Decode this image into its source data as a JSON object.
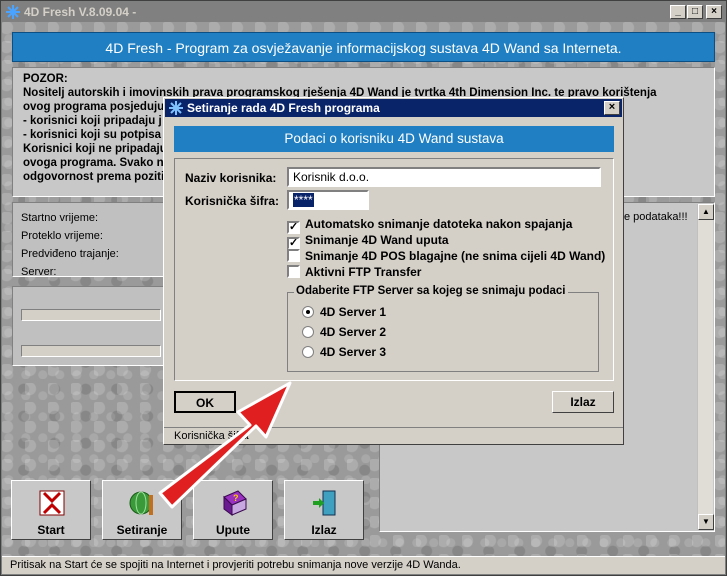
{
  "window": {
    "title": "4D Fresh V.8.09.04 -",
    "minimize": "_",
    "maximize": "□",
    "close": "×"
  },
  "banner": "4D Fresh - Program za osvježavanje informacijskog sustava 4D Wand sa Interneta.",
  "pozor": [
    "POZOR:",
    "Nositelj autorskih i imovinskih prava programskog rješenja 4D Wand je tvrtka 4th Dimension Inc. te pravo korištenja",
    "ovog programa posjeduju",
    "- korisnici koji pripadaju j",
    "- korisnici koji su potpisa",
    "Korisnici koji ne pripadaju                                                                                   o korištenja",
    "ovoga programa. Svako n                                                                                      aterijalnu",
    "odgovornost prema poziti"
  ],
  "info": {
    "start": "Startno vrijeme:",
    "elapsed": "Proteklo vrijeme:",
    "predicted": "Predviđeno trajanje:",
    "server": "Server:"
  },
  "log": {
    "text": "e podataka!!!"
  },
  "buttons": {
    "start": "Start",
    "settings": "Setiranje",
    "help": "Upute",
    "exit": "Izlaz"
  },
  "status": "Pritisak na Start će se spojiti na Internet i provjeriti potrebu snimanja nove verzije 4D Wanda.",
  "dialog": {
    "title": "Setiranje rada 4D Fresh programa",
    "close": "×",
    "banner": "Podaci o korisniku 4D Wand sustava",
    "username_label": "Naziv korisnika:",
    "username_value": "Korisnik d.o.o.",
    "password_label": "Korisnička šifra:",
    "password_value": "****",
    "checkboxes": [
      {
        "label": "Automatsko snimanje datoteka nakon spajanja",
        "checked": "✓"
      },
      {
        "label": "Snimanje 4D Wand uputa",
        "checked": "✓"
      },
      {
        "label": "Snimanje 4D POS blagajne (ne snima cijeli 4D Wand)",
        "checked": ""
      },
      {
        "label": "Aktivni FTP Transfer",
        "checked": ""
      }
    ],
    "group_title": "Odaberite FTP Server sa kojeg se snimaju podaci",
    "radios": [
      "4D Server 1",
      "4D Server 2",
      "4D Server 3"
    ],
    "selected_radio": 1,
    "ok": "OK",
    "exit": "Izlaz",
    "status": "Korisnička šifra"
  },
  "colors": {
    "banner": "#1f7fc2",
    "dialog_title": "#0a246a",
    "arrow": "#e02020"
  }
}
